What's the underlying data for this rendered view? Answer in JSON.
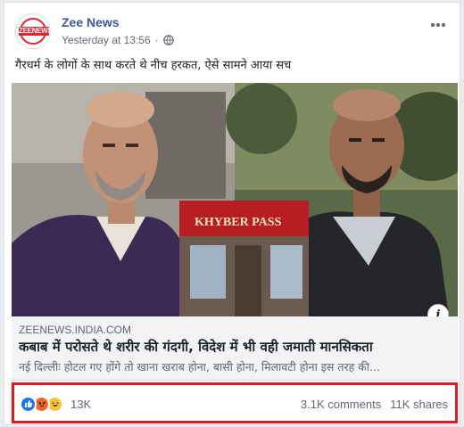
{
  "post": {
    "page_name": "Zee News",
    "avatar_text": "ZEENEWS",
    "timestamp": "Yesterday at 13:56",
    "separator": "·",
    "caption": "गैरधर्म के लोगों के साथ करते थे नीच हरकत, ऐसे सामने आया सच"
  },
  "image": {
    "sign_text": "KHYBER PASS",
    "info_label": "i"
  },
  "link": {
    "domain": "ZEENEWS.INDIA.COM",
    "headline": "कबाब में परोसते थे शरीर की गंदगी, विदेश में भी वही जमाती मानसिकता",
    "snippet": "नई दिल्लीः होटल गए होंगे तो खाना खराब होना, बासी होना, मिलावटी होना इस तरह की..."
  },
  "engagement": {
    "reactions_count": "13K",
    "comments": "3.1K comments",
    "shares": "11K shares"
  },
  "colors": {
    "name_link": "#385898",
    "highlight_border": "#e5181f",
    "like": "#1877f2"
  }
}
